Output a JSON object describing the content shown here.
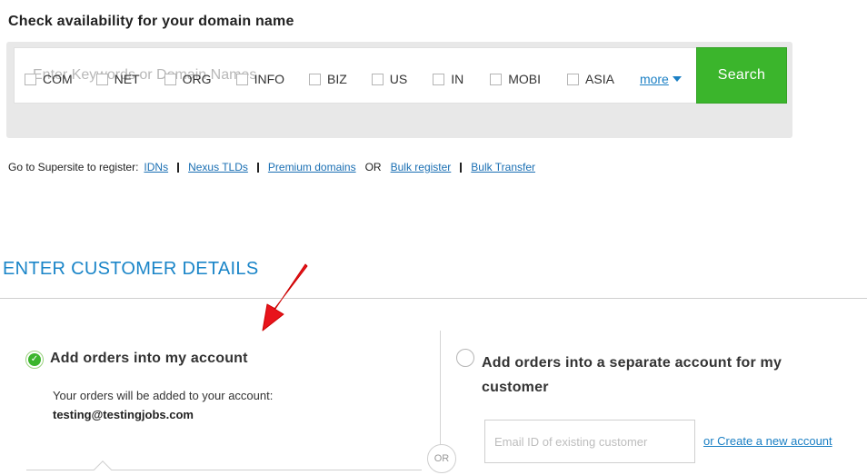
{
  "heading": "Check availability for your domain name",
  "search": {
    "placeholder": "Enter Keywords or Domain Names",
    "value": "",
    "button_label": "Search"
  },
  "tlds": [
    {
      "label": "COM",
      "checked": false
    },
    {
      "label": "NET",
      "checked": false
    },
    {
      "label": "ORG",
      "checked": false
    },
    {
      "label": "INFO",
      "checked": false
    },
    {
      "label": "BIZ",
      "checked": false
    },
    {
      "label": "US",
      "checked": false
    },
    {
      "label": "IN",
      "checked": false
    },
    {
      "label": "MOBI",
      "checked": false
    },
    {
      "label": "ASIA",
      "checked": false
    }
  ],
  "more_label": "more",
  "supersite": {
    "prefix": "Go to Supersite to register:",
    "links": [
      "IDNs",
      "Nexus TLDs",
      "Premium domains",
      "Bulk register",
      "Bulk Transfer"
    ],
    "or_text": "OR"
  },
  "section_title": "ENTER CUSTOMER DETAILS",
  "option_own": {
    "label": "Add orders into my account",
    "selected": true,
    "description": "Your orders will be added to your account:",
    "email": "testing@testingjobs.com"
  },
  "or_divider": "OR",
  "option_separate": {
    "label": "Add orders into a separate account for my customer",
    "selected": false,
    "email_placeholder": "Email ID of existing customer",
    "create_link": "or Create a new account"
  },
  "colors": {
    "accent_green": "#3bb52c",
    "link_blue": "#1a7fc4",
    "section_blue": "#1a85c8",
    "annotation_red": "#e8141c"
  }
}
